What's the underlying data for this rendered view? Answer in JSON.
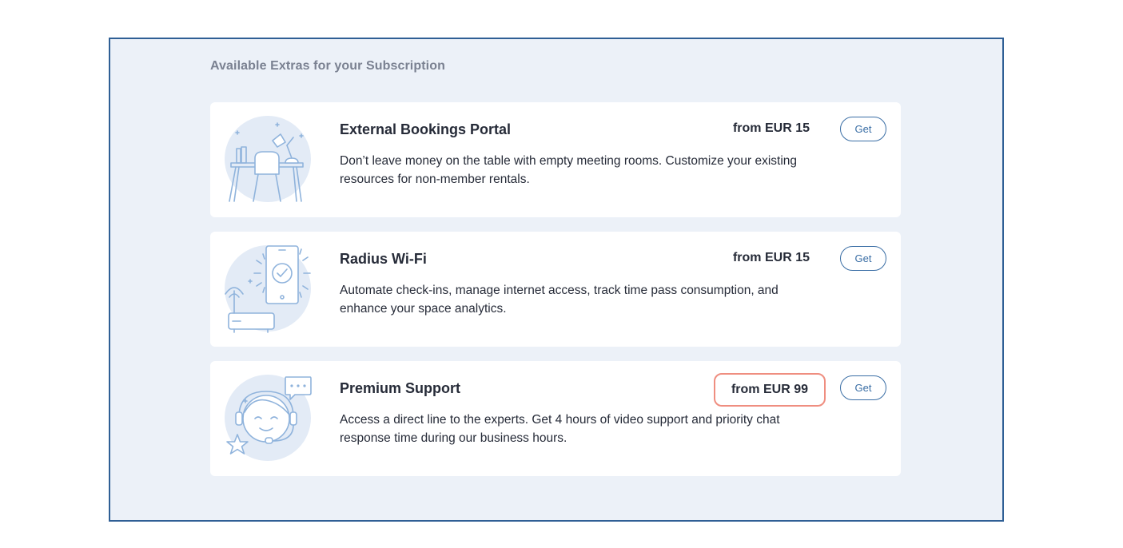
{
  "section": {
    "title": "Available Extras for your Subscription"
  },
  "extras": [
    {
      "title": "External Bookings Portal",
      "price": "from EUR 15",
      "description": "Don’t leave money on the table with empty meeting rooms. Customize your existing resources for non-member rentals.",
      "button": "Get",
      "illustration": "desk-chair-lamp-icon"
    },
    {
      "title": "Radius Wi-Fi",
      "price": "from EUR 15",
      "description": "Automate check-ins, manage internet access, track time pass consumption, and enhance your space analytics.",
      "button": "Get",
      "illustration": "phone-checkmark-router-icon"
    },
    {
      "title": "Premium Support",
      "price": "from EUR 99",
      "description": "Access a direct line to the experts. Get 4 hours of video support and priority chat response time during our business hours.",
      "button": "Get",
      "illustration": "support-agent-headset-icon"
    }
  ],
  "colors": {
    "accent": "#3a6ea5",
    "panel_background": "#ecf1f8",
    "frame_border": "#2f5f95",
    "price_highlight": "#ef8e80",
    "illustration_line": "#8fb3dc",
    "illustration_circle": "#e3ebf6"
  }
}
